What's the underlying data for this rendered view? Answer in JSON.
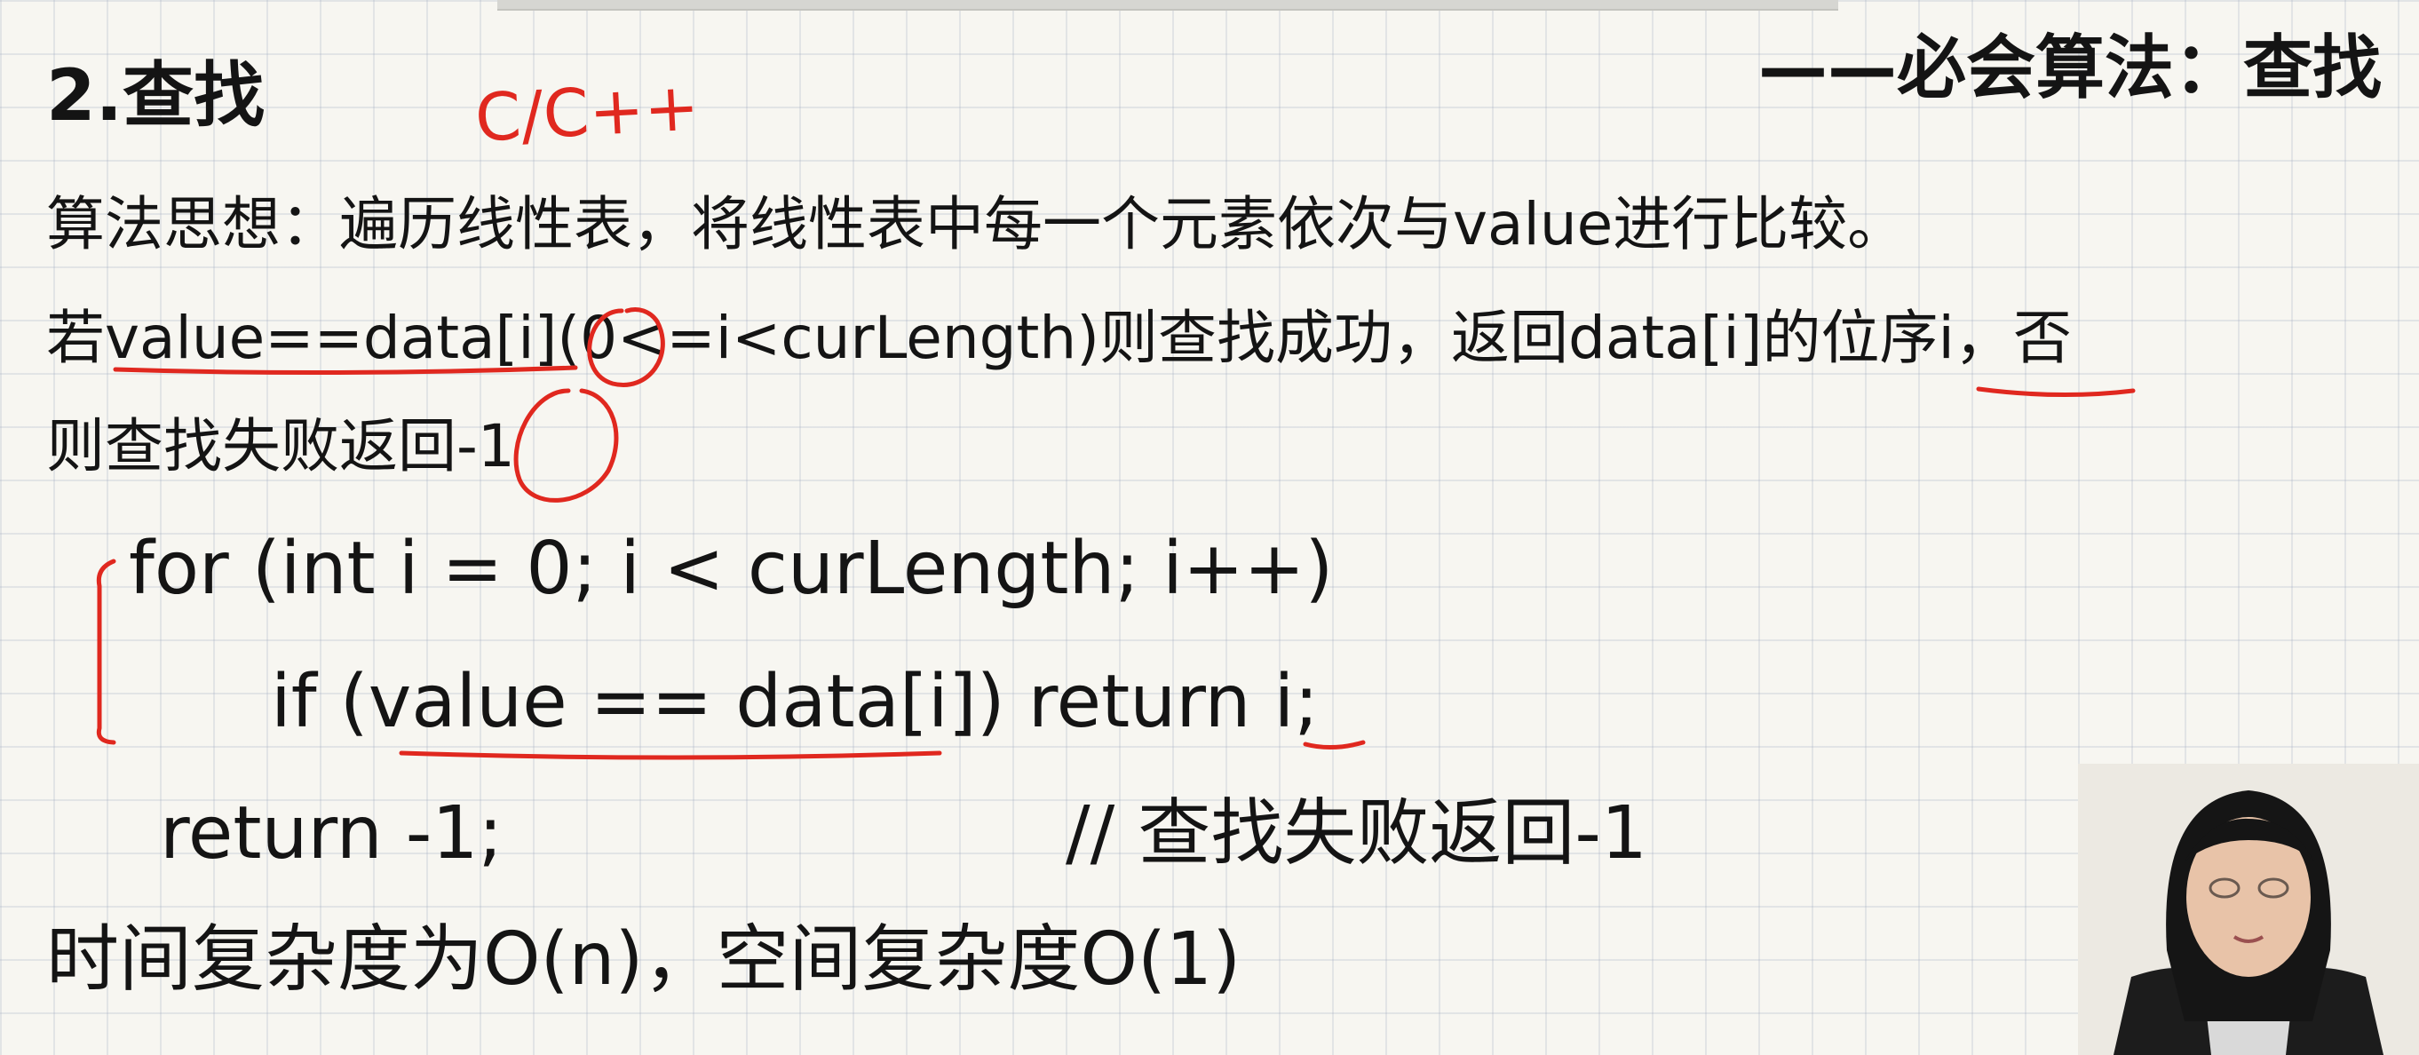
{
  "header": {
    "title": "2.查找",
    "series": "——必会算法：查找",
    "annotation": "C/C++"
  },
  "content": {
    "line1": "算法思想：遍历线性表，将线性表中每一个元素依次与value进行比较。",
    "line2": "若value==data[i](0<=i<curLength)则查找成功，返回data[i]的位序i，否",
    "line3": "则查找失败返回-1"
  },
  "code": {
    "line1": "for (int i = 0; i < curLength; i++)",
    "line2": "if (value == data[i]) return i;",
    "line3": "return -1;",
    "comment": "// 查找失败返回-1"
  },
  "complexity": "时间复杂度为O(n)，空间复杂度O(1)",
  "colors": {
    "ink": "#141414",
    "annotation": "#e0281f",
    "paper": "#f7f6f1",
    "grid": "#c8d0da"
  }
}
